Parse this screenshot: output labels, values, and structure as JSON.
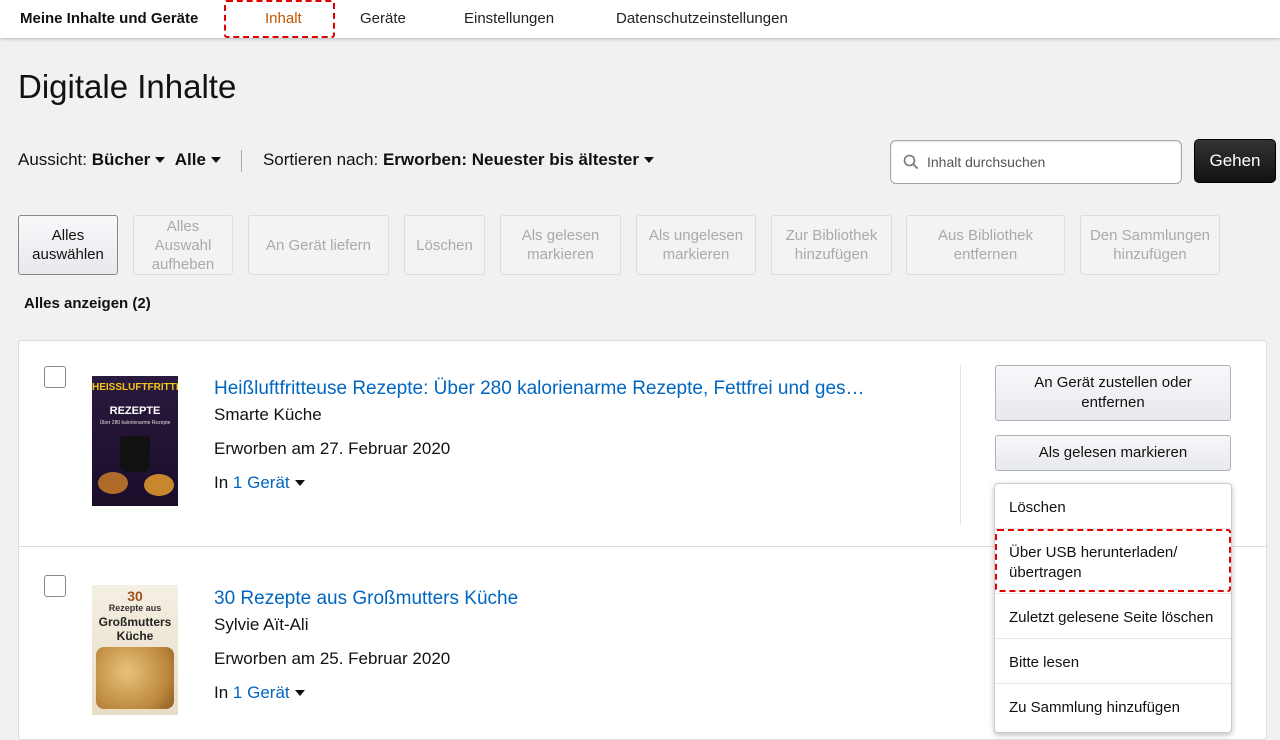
{
  "nav": {
    "brand": "Meine Inhalte und Geräte",
    "tabs": [
      "Inhalt",
      "Geräte",
      "Einstellungen",
      "Datenschutzeinstellungen"
    ],
    "active_tab": "Inhalt"
  },
  "page": {
    "title": "Digitale Inhalte"
  },
  "filters": {
    "view_label": "Aussicht:",
    "view_value": "Bücher",
    "view_scope": "Alle",
    "sort_label": "Sortieren nach:",
    "sort_value": "Erworben: Neuester bis ältester"
  },
  "search": {
    "placeholder": "Inhalt durchsuchen",
    "go_label": "Gehen"
  },
  "actions": [
    {
      "line1": "Alles",
      "line2": "auswählen"
    },
    {
      "line1": "Alles",
      "line2": "Auswahl",
      "line3": "aufheben"
    },
    {
      "line1": "An Gerät liefern"
    },
    {
      "line1": "Löschen"
    },
    {
      "line1": "Als gelesen",
      "line2": "markieren"
    },
    {
      "line1": "Als ungelesen",
      "line2": "markieren"
    },
    {
      "line1": "Zur Bibliothek",
      "line2": "hinzufügen"
    },
    {
      "line1": "Aus Bibliothek",
      "line2": "entfernen"
    },
    {
      "line1": "Den Sammlungen",
      "line2": "hinzufügen"
    }
  ],
  "show_all": "Alles anzeigen (2)",
  "items": [
    {
      "title": "Heißluftfritteuse Rezepte: Über 280 kalorienarme Rezepte, Fettfrei und ges…",
      "author": "Smarte Küche",
      "acquired": "Erworben am 27. Februar 2020",
      "devices_prefix": "In",
      "devices_link": "1 Gerät",
      "cover": {
        "line1": "HEISSLUFTFRITTEUSE",
        "line2": "REZEPTE",
        "small": "Über 280 kalorienarme Rezepte"
      }
    },
    {
      "title": "30 Rezepte aus Großmutters Küche",
      "author": "Sylvie Aït-Ali",
      "acquired": "Erworben am 25. Februar 2020",
      "devices_prefix": "In",
      "devices_link": "1 Gerät",
      "cover": {
        "line1": "30",
        "line2": "Rezepte aus",
        "line3": "Großmutters",
        "line4": "Küche"
      }
    }
  ],
  "row_actions": {
    "deliver": {
      "line1": "An Gerät zustellen oder",
      "line2": "entfernen"
    },
    "mark_read": "Als gelesen markieren"
  },
  "menu": {
    "items": [
      {
        "line1": "Löschen"
      },
      {
        "line1": "Über USB herunterladen/",
        "line2": "übertragen"
      },
      {
        "line1": "Zuletzt gelesene Seite löschen"
      },
      {
        "line1": "Bitte lesen"
      },
      {
        "line1": "Zu Sammlung hinzufügen"
      }
    ]
  },
  "colors": {
    "link": "#0066c0",
    "active_tab": "#c45500",
    "highlight": "#e00000"
  }
}
